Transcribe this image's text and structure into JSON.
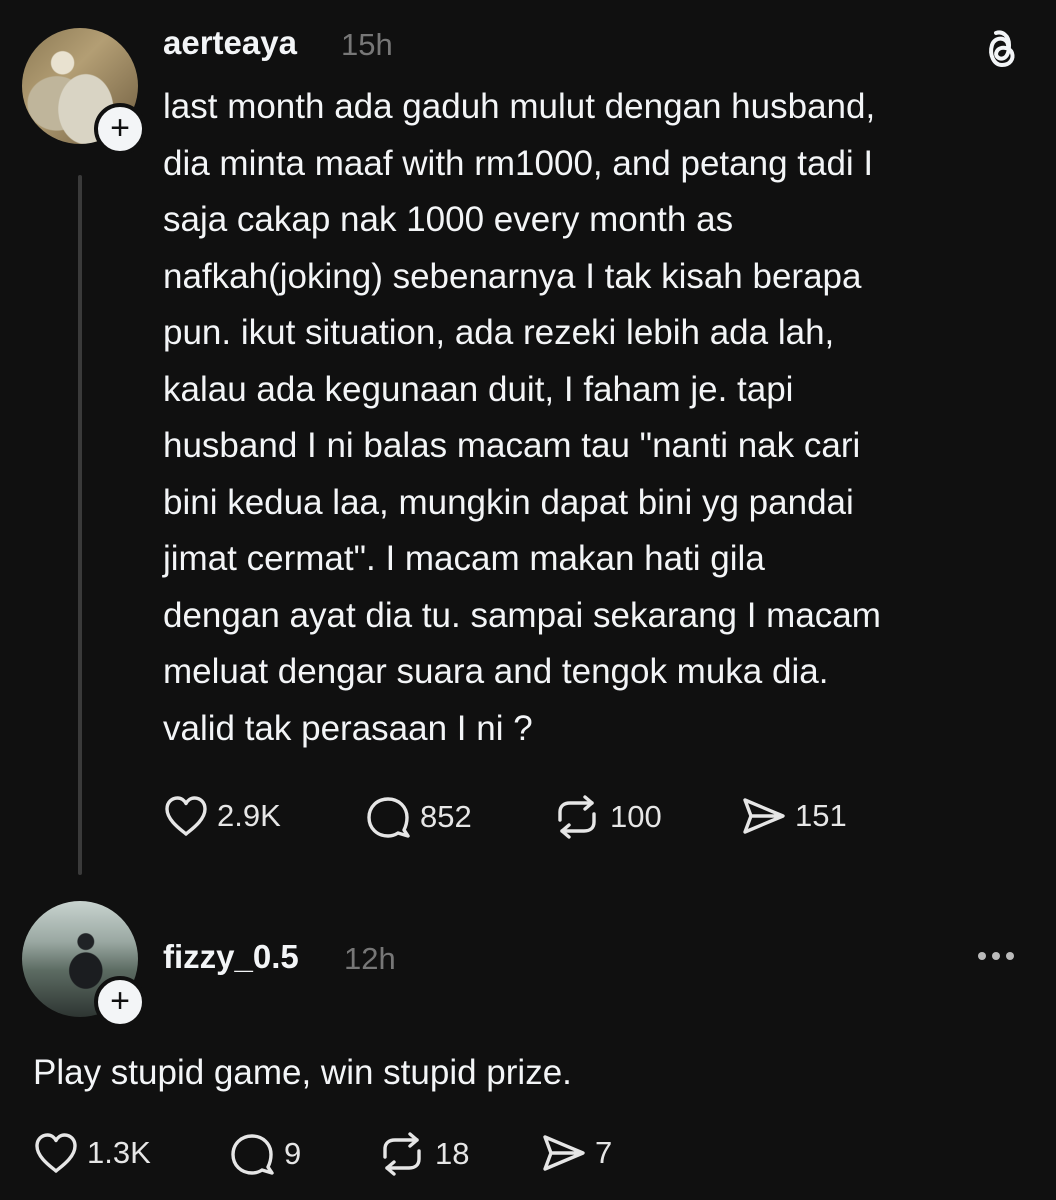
{
  "posts": [
    {
      "username": "aerteaya",
      "time": "15h",
      "text": "last month ada gaduh mulut dengan husband,\ndia minta maaf with rm1000, and petang tadi I\nsaja cakap nak 1000 every month as\nnafkah(joking) sebenarnya I tak kisah berapa\npun. ikut situation, ada rezeki lebih ada lah,\nkalau ada kegunaan duit, I faham je. tapi\nhusband I ni balas macam tau \"nanti nak cari\nbini kedua laa, mungkin dapat bini yg pandai\njimat cermat\". I macam makan hati gila\ndengan ayat dia tu. sampai sekarang I macam\nmeluat dengar suara and tengok muka dia.\nvalid tak perasaan I ni ?",
      "likes": "2.9K",
      "comments": "852",
      "reposts": "100",
      "shares": "151",
      "corner_icon": "threads-logo-icon"
    },
    {
      "username": "fizzy_0.5",
      "time": "12h",
      "text": "Play stupid game, win stupid prize.",
      "likes": "1.3K",
      "comments": "9",
      "reposts": "18",
      "shares": "7",
      "corner_icon": "more-icon"
    }
  ],
  "colors": {
    "background": "#101010",
    "text": "#f3f5f7",
    "secondary": "#777777",
    "thread_line": "#3a3a3a"
  }
}
